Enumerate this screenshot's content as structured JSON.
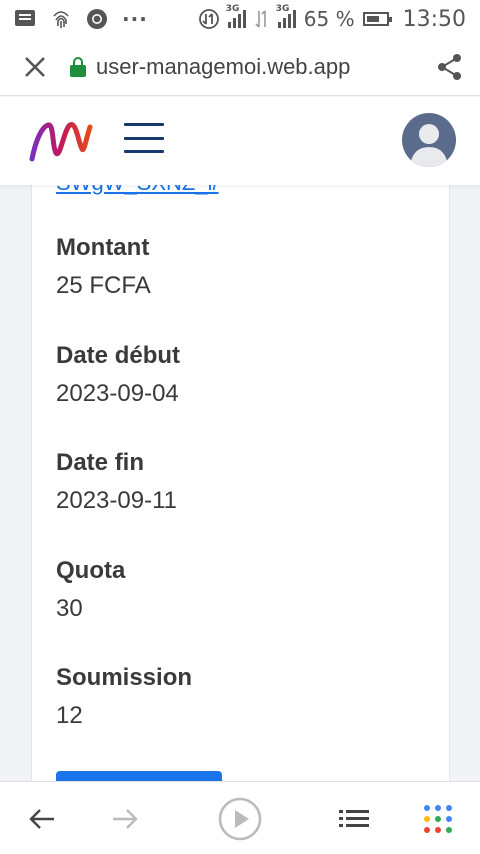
{
  "status_bar": {
    "network_label_1": "3G",
    "network_label_2": "3G",
    "battery_percent": "65 %",
    "time": "13:50",
    "icons": [
      "message-icon",
      "fingerprint-icon",
      "chrome-icon",
      "more-dots-icon",
      "data-transfer-icon",
      "signal-icon",
      "data-arrows-icon",
      "signal-icon",
      "battery-icon"
    ]
  },
  "browser": {
    "url": "user-managemoi.web.app",
    "close_icon": "close-icon",
    "lock_icon": "lock-icon",
    "share_icon": "share-icon",
    "lock_color": "#1e8e3e"
  },
  "app_header": {
    "logo_icon": "m-logo-icon",
    "menu_icon": "hamburger-icon",
    "avatar_icon": "user-avatar-icon",
    "menu_color": "#1a3a6b",
    "avatar_color": "#5a6b8c"
  },
  "details": {
    "truncated_link": "SWgW_SXNZ_i/",
    "fields": [
      {
        "label": "Montant",
        "value": "25 FCFA"
      },
      {
        "label": "Date début",
        "value": "2023-09-04"
      },
      {
        "label": "Date fin",
        "value": "2023-09-11"
      },
      {
        "label": "Quota",
        "value": "30"
      },
      {
        "label": "Soumission",
        "value": "12"
      }
    ],
    "button_color": "#1a73e8"
  },
  "bottom_nav": {
    "items": [
      "back-arrow-icon",
      "forward-arrow-icon",
      "play-circle-icon",
      "list-icon",
      "apps-grid-icon"
    ]
  }
}
